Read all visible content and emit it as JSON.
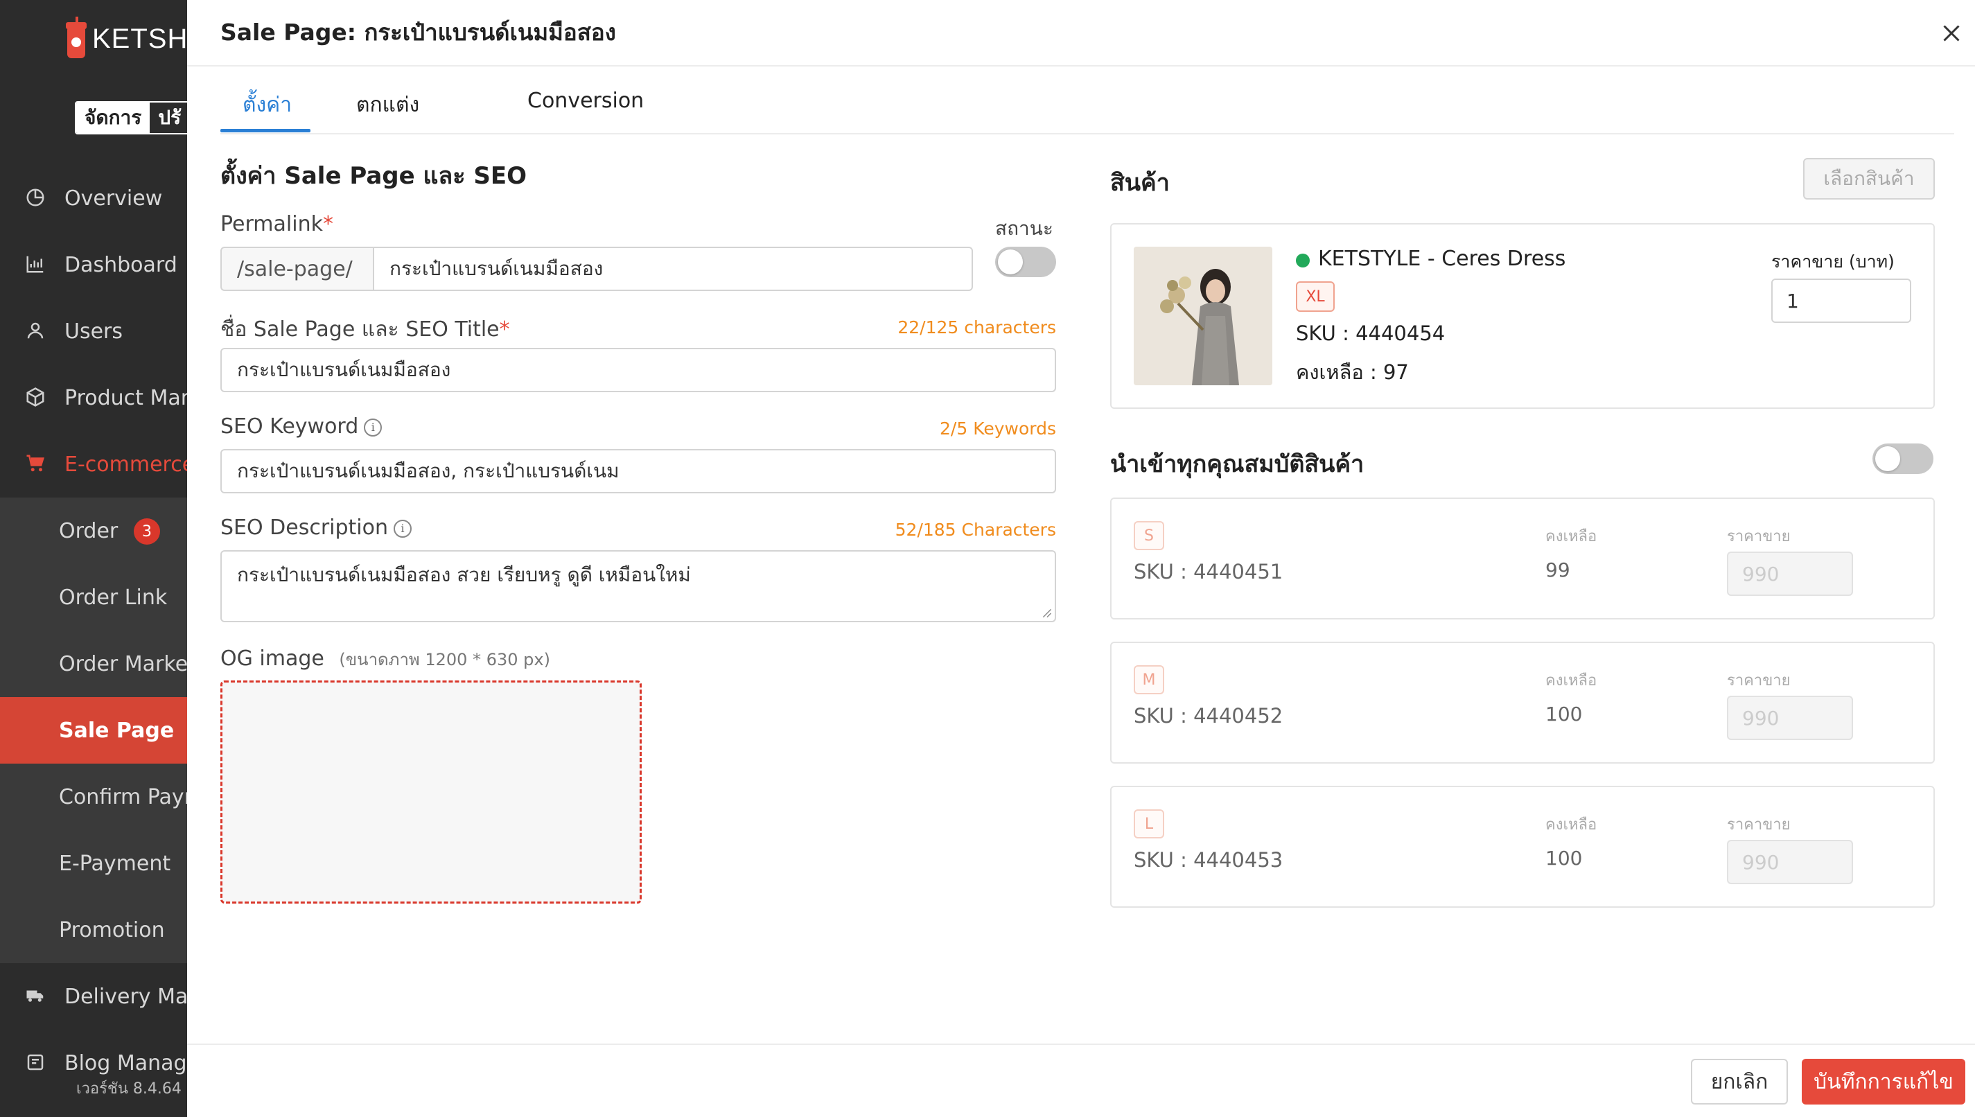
{
  "sidebar": {
    "logo_text": "KETSHO",
    "mode_manage": "จัดการ",
    "mode_other": "ปรั",
    "items": [
      {
        "label": "Overview",
        "icon": "pie-chart-icon"
      },
      {
        "label": "Dashboard",
        "icon": "bar-chart-icon"
      },
      {
        "label": "Users",
        "icon": "user-icon"
      },
      {
        "label": "Product Man",
        "icon": "box-icon"
      },
      {
        "label": "E-commerce",
        "icon": "cart-icon"
      }
    ],
    "sub_items": [
      {
        "label": "Order",
        "badge": "3"
      },
      {
        "label": "Order Link"
      },
      {
        "label": "Order Market"
      },
      {
        "label": "Sale Page"
      },
      {
        "label": "Confirm Paym"
      },
      {
        "label": "E-Payment"
      },
      {
        "label": "Promotion"
      }
    ],
    "bottom_items": [
      {
        "label": "Delivery Man",
        "icon": "truck-icon"
      },
      {
        "label": "Blog Manage",
        "icon": "blog-icon"
      }
    ],
    "version": "เวอร์ชัน 8.4.64",
    "accent": "#e64a3b"
  },
  "drawer": {
    "title": "Sale Page: กระเป๋าแบรนด์เนมมือสอง",
    "tabs": [
      "ตั้งค่า",
      "ตกแต่ง",
      "Conversion"
    ],
    "active_tab": "ตั้งค่า"
  },
  "settings": {
    "section_title": "ตั้งค่า Sale Page และ SEO",
    "permalink_label": "Permalink",
    "permalink_prefix": "/sale-page/",
    "permalink_value": "กระเป๋าแบรนด์เนมมือสอง",
    "status_label": "สถานะ",
    "status_on": false,
    "seo_title_label": "ชื่อ Sale Page และ SEO Title",
    "seo_title_counter": "22/125 characters",
    "seo_title_value": "กระเป๋าแบรนด์เนมมือสอง",
    "seo_keyword_label": "SEO Keyword",
    "seo_keyword_counter": "2/5 Keywords",
    "seo_keyword_value": "กระเป๋าแบรนด์เนมมือสอง, กระเป๋าแบรนด์เนม",
    "seo_desc_label": "SEO Description",
    "seo_desc_counter": "52/185 Characters",
    "seo_desc_value": "กระเป๋าแบรนด์เนมมือสอง สวย เรียบหรู ดูดี เหมือนใหม่",
    "og_label": "OG image",
    "og_hint": "(ขนาดภาพ 1200 * 630 px)",
    "required_mark": "*",
    "info_glyph": "i"
  },
  "product": {
    "section_title": "สินค้า",
    "select_button": "เลือกสินค้า",
    "name": "KETSTYLE - Ceres Dress",
    "size": "XL",
    "sku": "SKU : 4440454",
    "stock": "คงเหลือ : 97",
    "price_label": "ราคาขาย (บาท)",
    "price_value": "1",
    "status_color": "#22a95a"
  },
  "import_all": {
    "title": "นำเข้าทุกคุณสมบัติสินค้า",
    "on": false,
    "stock_label": "คงเหลือ",
    "price_label": "ราคาขาย",
    "variants": [
      {
        "size": "S",
        "sku": "SKU : 4440451",
        "stock": "99",
        "price": "990"
      },
      {
        "size": "M",
        "sku": "SKU : 4440452",
        "stock": "100",
        "price": "990"
      },
      {
        "size": "L",
        "sku": "SKU : 4440453",
        "stock": "100",
        "price": "990"
      }
    ]
  },
  "footer": {
    "cancel": "ยกเลิก",
    "save": "บันทึกการแก้ไข"
  }
}
